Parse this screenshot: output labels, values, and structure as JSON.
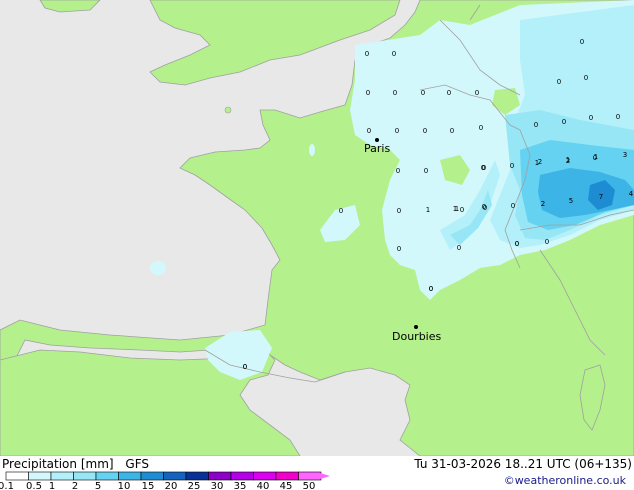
{
  "title": "Precipitation [mm]",
  "model": "GFS",
  "valid_time": "Tu 31-03-2026 18..21 UTC (06+135)",
  "credit": "©weatheronline.co.uk",
  "colors": {
    "sea": "#e8e8e8",
    "land": "#b4f08c",
    "border": "#a0a0a0",
    "p01": "#d2f8fc",
    "p05": "#b4f0fa",
    "p1": "#96e6f5",
    "p2": "#64d2f0",
    "p5": "#3cb4e6",
    "p10": "#1e8cd2"
  },
  "cities": [
    {
      "name": "Paris"
    },
    {
      "name": "Dourbies"
    }
  ],
  "grid_values": [
    "0",
    "0",
    "0",
    "0",
    "0",
    "0",
    "0",
    "0",
    "0",
    "0",
    "0",
    "0",
    "0",
    "0",
    "0",
    "0",
    "0",
    "0",
    "0",
    "0",
    "0",
    "0",
    "0",
    "0",
    "1",
    "1",
    "0",
    "0",
    "1",
    "1",
    "0",
    "0",
    "0",
    "0",
    "0",
    "0",
    "0",
    "0",
    "0",
    "2",
    "2",
    "1",
    "3",
    "2",
    "5",
    "7",
    "4",
    "0",
    "0",
    "1",
    "0",
    "0",
    "0"
  ],
  "legend": {
    "ticks": [
      "0.1",
      "0.5",
      "1",
      "2",
      "5",
      "10",
      "15",
      "20",
      "25",
      "30",
      "35",
      "40",
      "45",
      "50"
    ],
    "colors": [
      "#ffffff",
      "#d2f8fc",
      "#b4f0fa",
      "#96e6f5",
      "#64d2f0",
      "#3cb4e6",
      "#1e8cd2",
      "#1464be",
      "#0a3296",
      "#8c00c8",
      "#b400e6",
      "#dc00f0",
      "#f000c8",
      "#ff64ff"
    ]
  }
}
